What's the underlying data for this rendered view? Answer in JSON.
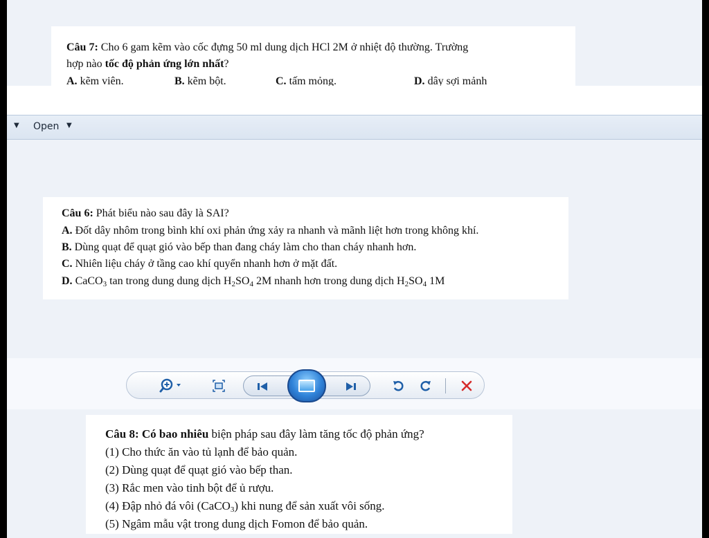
{
  "question7": {
    "label": "Câu 7:",
    "text_line1": " Cho 6 gam kẽm vào cốc đựng 50 ml dung dịch HCl 2M ở nhiệt độ thường. Trường",
    "text_line2_prefix": "hợp nào ",
    "text_line2_bold": "tốc độ phản ứng lớn nhất",
    "text_line2_suffix": "?",
    "options": [
      {
        "label": "A.",
        "text": " kẽm viên."
      },
      {
        "label": "B.",
        "text": " kẽm bột."
      },
      {
        "label": "C.",
        "text": " tấm mỏng."
      },
      {
        "label": "D.",
        "text": " dây sợi mảnh"
      }
    ]
  },
  "open_bar": {
    "open_label": "Open",
    "menu_arrow_icon": "triangle-down-icon"
  },
  "question6": {
    "label": "Câu 6:",
    "text": " Phát biểu nào sau đây là SAI?",
    "options": [
      {
        "label": "A.",
        "text": " Đốt dây nhôm trong bình khí oxi phản ứng xảy ra nhanh và mãnh liệt hơn trong không khí."
      },
      {
        "label": "B.",
        "text": " Dùng quạt để quạt gió vào bếp than đang cháy làm cho than cháy nhanh hơn."
      },
      {
        "label": "C.",
        "text": " Nhiên liệu cháy ở tầng cao khí quyển nhanh hơn ở mặt đất."
      },
      {
        "label": "D.",
        "text_a": " CaCO",
        "sub_a": "3",
        "text_b": " tan trong dung dung dịch H",
        "sub_b": "2",
        "text_c": "SO",
        "sub_c": "4",
        "text_d": " 2M nhanh hơn trong dung dịch H",
        "sub_d": "2",
        "text_e": "SO",
        "sub_e": "4",
        "text_f": " 1M"
      }
    ]
  },
  "viewer_toolbar": {
    "icons": [
      "zoom-in-icon",
      "fit-window-icon",
      "previous-icon",
      "slideshow-icon",
      "next-icon",
      "rotate-left-icon",
      "rotate-right-icon",
      "delete-icon"
    ],
    "accent_color": "#1f5fa8",
    "delete_color": "#d62b2b"
  },
  "question8": {
    "label": "Câu 8:",
    "label_bold2": " Có bao nhiêu",
    "text": " biện pháp sau đây làm tăng tốc độ phản ứng?",
    "items": [
      {
        "num": "(1)",
        "text": "  Cho thức ăn vào tủ lạnh để bảo quản."
      },
      {
        "num": "(2)",
        "text": "  Dùng quạt để quạt gió vào bếp than."
      },
      {
        "num": "(3)",
        "text": "  Rắc men vào tinh bột để ủ rượu."
      },
      {
        "num": "(4)",
        "text_a": "  Đập nhỏ đá vôi (CaCO",
        "sub": "3",
        "text_b": ") khi nung để sản xuất vôi sống."
      },
      {
        "num": "(5)",
        "text": "  Ngâm mẫu vật trong dung dịch Fomon để bảo quản."
      }
    ]
  }
}
